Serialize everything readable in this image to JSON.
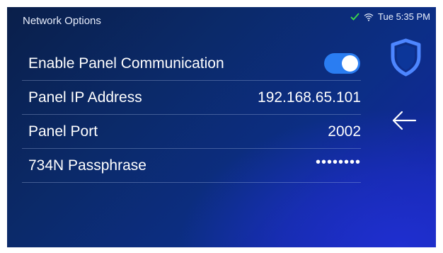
{
  "header": {
    "title": "Network Options"
  },
  "status": {
    "time": "Tue 5:35 PM",
    "check_icon": "check-icon",
    "wifi_icon": "wifi-icon",
    "check_color": "#3ddc4a"
  },
  "rows": [
    {
      "label": "Enable Panel Communication",
      "toggle_on": true
    },
    {
      "label": "Panel IP Address",
      "value": "192.168.65.101"
    },
    {
      "label": "Panel Port",
      "value": "2002"
    },
    {
      "label": "734N Passphrase",
      "value": "••••••••"
    }
  ],
  "side_buttons": {
    "shield_icon": "shield-icon",
    "back_icon": "back-arrow-icon"
  },
  "colors": {
    "accent": "#2a7df2",
    "background": "#0b2a6a"
  }
}
